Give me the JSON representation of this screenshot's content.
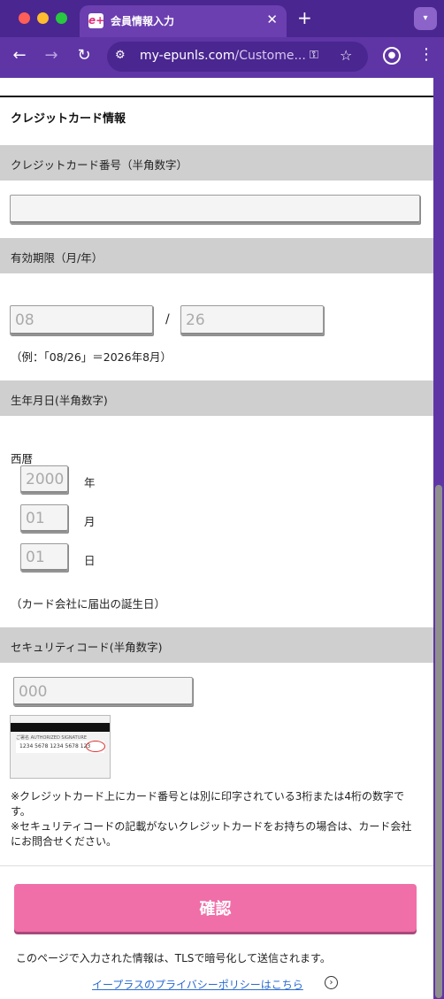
{
  "browser": {
    "tab_title": "会員情報入力",
    "favicon_text": "e+",
    "url_host": "my-epunls.com",
    "url_path": "/Custome...",
    "close_glyph": "✕",
    "new_tab_glyph": "+"
  },
  "form": {
    "section_title": "クレジットカード情報",
    "card_number": {
      "label": "クレジットカード番号（半角数字）",
      "value": "",
      "placeholder": ""
    },
    "expiry": {
      "label": "有効期限（月/年）",
      "month_placeholder": "08",
      "year_placeholder": "26",
      "separator": "/",
      "example": "（例：「08/26」＝2026年8月）"
    },
    "birthdate": {
      "label": "生年月日(半角数字)",
      "era": "西暦",
      "year_placeholder": "2000",
      "year_unit": "年",
      "month_placeholder": "01",
      "month_unit": "月",
      "day_placeholder": "01",
      "day_unit": "日",
      "note": "（カード会社に届出の誕生日）"
    },
    "security_code": {
      "label": "セキュリティコード(半角数字)",
      "placeholder": "000",
      "card_image": {
        "signature_label": "ご署名 AUTHORIZED SIGNATURE",
        "sample_numbers": "1234 5678 1234 5678 123"
      },
      "note1": "※クレジットカード上にカード番号とは別に印字されている3桁または4桁の数字です。",
      "note2": "※セキュリティコードの記載がないクレジットカードをお持ちの場合は、カード会社にお問合せください。"
    }
  },
  "footer": {
    "confirm_label": "確認",
    "tls_note": "このページで入力された情報は、TLSで暗号化して送信されます。",
    "privacy_link": "イープラスのプライバシーポリシーはこちら",
    "privacy_glyph": "›"
  },
  "colors": {
    "chrome": "#5f35a6",
    "confirm_button": "#f06fa8",
    "band": "#cfcfcf",
    "link": "#2a6bd1"
  }
}
